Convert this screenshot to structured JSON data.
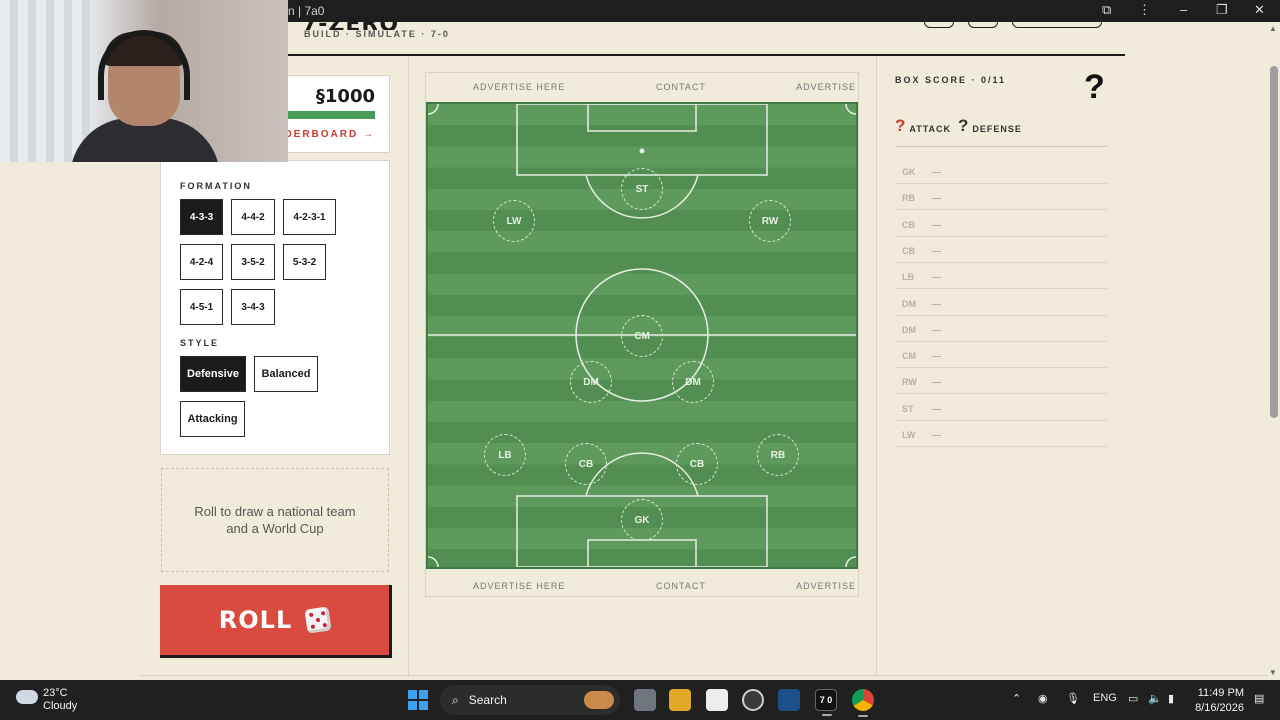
{
  "browser": {
    "tab_title": "n | 7a0"
  },
  "header": {
    "title": "7-ZERO",
    "tagline": "BUILD · SIMULATE · 7-0"
  },
  "wallet": {
    "amount": "§1000",
    "leaderboard_link": "ADERBOARD →"
  },
  "formation": {
    "label": "FORMATION",
    "options": [
      "4-3-3",
      "4-4-2",
      "4-2-3-1",
      "4-2-4",
      "3-5-2",
      "5-3-2",
      "4-5-1",
      "3-4-3"
    ],
    "selected": "4-3-3"
  },
  "style": {
    "label": "STYLE",
    "options": [
      "Defensive",
      "Balanced",
      "Attacking"
    ],
    "selected": "Defensive"
  },
  "draw_prompt": "Roll to draw a national team and a World Cup",
  "roll_button": {
    "label": "ROLL",
    "icon": "dice-icon"
  },
  "ads": {
    "left": "ADVERTISE HERE",
    "center": "CONTACT",
    "right": "ADVERTISE"
  },
  "pitch": {
    "positions": [
      "ST",
      "LW",
      "RW",
      "CM",
      "DM",
      "DM",
      "LB",
      "CB",
      "CB",
      "RB",
      "GK"
    ]
  },
  "box_score": {
    "title": "BOX SCORE · 0/11",
    "big_icon": "?",
    "legend": [
      {
        "icon": "?",
        "label": "ATTACK",
        "color": "#c93a2c"
      },
      {
        "icon": "?",
        "label": "DEFENSE",
        "color": "#1b1b1b"
      }
    ],
    "rows": [
      {
        "pos": "GK",
        "player": "—"
      },
      {
        "pos": "RB",
        "player": "—"
      },
      {
        "pos": "CB",
        "player": "—"
      },
      {
        "pos": "CB",
        "player": "—"
      },
      {
        "pos": "LB",
        "player": "—"
      },
      {
        "pos": "DM",
        "player": "—"
      },
      {
        "pos": "DM",
        "player": "—"
      },
      {
        "pos": "CM",
        "player": "—"
      },
      {
        "pos": "RW",
        "player": "—"
      },
      {
        "pos": "ST",
        "player": "—"
      },
      {
        "pos": "LW",
        "player": "—"
      }
    ]
  },
  "taskbar": {
    "weather_temp": "23°C",
    "weather_cond": "Cloudy",
    "search_label": "Search",
    "lang": "ENG",
    "time": "11:49 PM",
    "date": "8/16/2026",
    "active_app_label": "7 0"
  },
  "colors": {
    "background": "#f0ebdb",
    "accent_red": "#d94b3e",
    "pitch_green": "#5d9a5c",
    "ink": "#1b1b1b"
  }
}
